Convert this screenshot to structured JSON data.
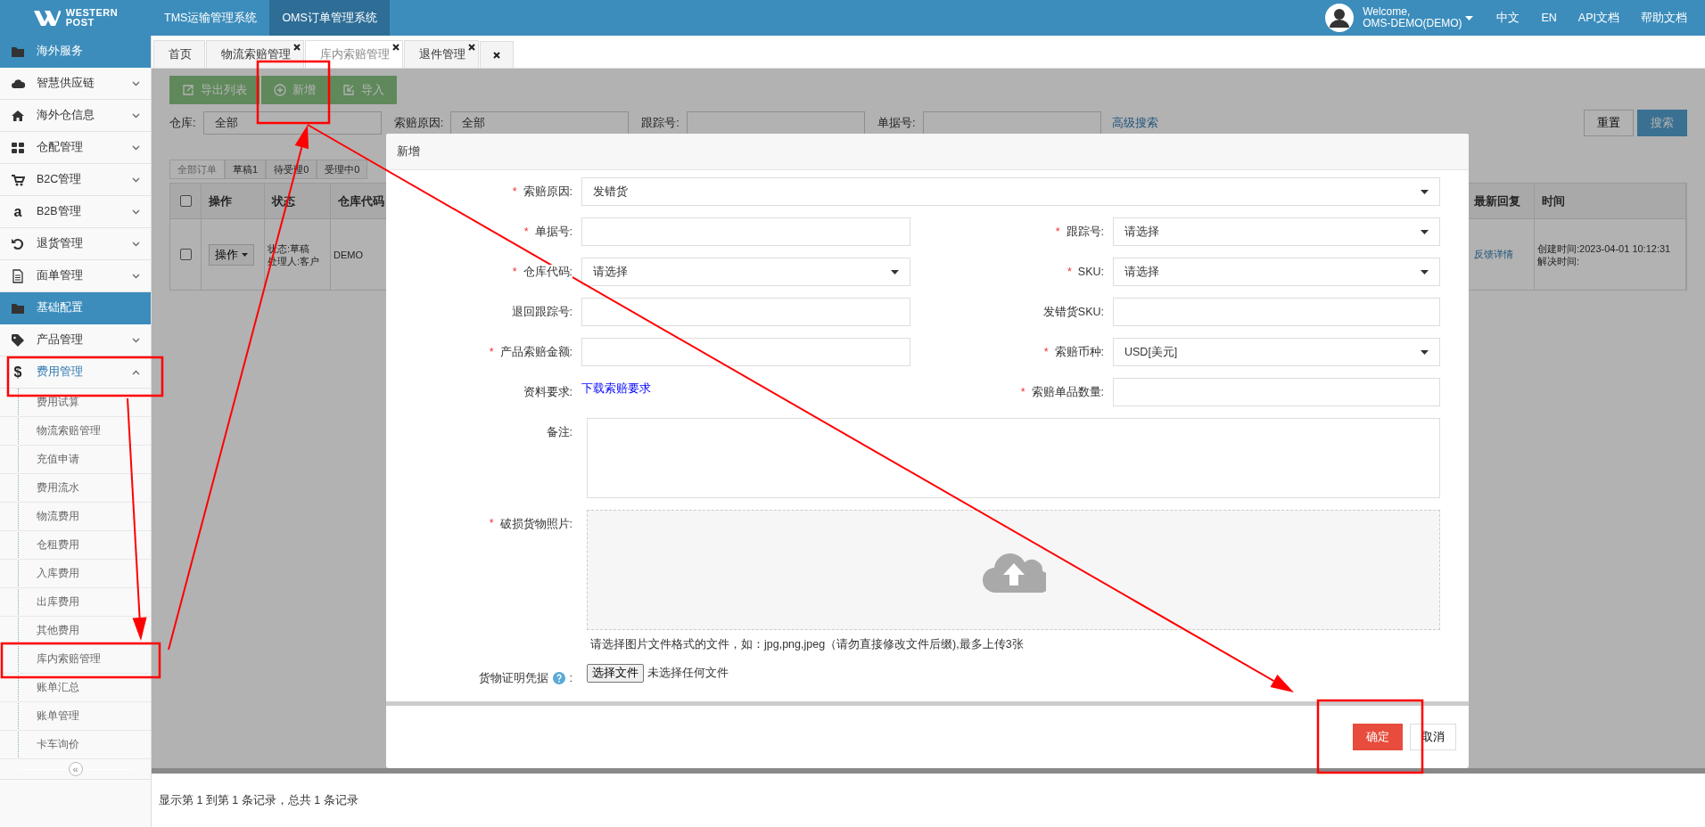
{
  "topbar": {
    "logo_line1": "WESTERN",
    "logo_line2": "POST",
    "nav": [
      {
        "label": "TMS运输管理系统",
        "selected": false
      },
      {
        "label": "OMS订单管理系统",
        "selected": true
      }
    ],
    "welcome": "Welcome,",
    "user": "OMS-DEMO(DEMO)",
    "links": [
      "中文",
      "EN",
      "API文档",
      "帮助文档"
    ]
  },
  "sidebar": {
    "items": [
      {
        "kind": "section",
        "label": "海外服务"
      },
      {
        "kind": "menu",
        "label": "智慧供应链",
        "expanded": false
      },
      {
        "kind": "menu",
        "label": "海外仓信息",
        "expanded": false
      },
      {
        "kind": "menu",
        "label": "仓配管理",
        "expanded": false
      },
      {
        "kind": "menu",
        "label": "B2C管理",
        "expanded": false
      },
      {
        "kind": "menu",
        "glyph": "a",
        "label": "B2B管理",
        "expanded": false
      },
      {
        "kind": "menu",
        "label": "退货管理",
        "expanded": false
      },
      {
        "kind": "menu",
        "label": "面单管理",
        "expanded": false
      },
      {
        "kind": "section",
        "label": "基础配置"
      },
      {
        "kind": "menu",
        "label": "产品管理",
        "expanded": false
      },
      {
        "kind": "menu",
        "glyph": "$",
        "label": "费用管理",
        "expanded": true,
        "children": [
          {
            "label": "费用试算"
          },
          {
            "label": "物流索赔管理"
          },
          {
            "label": "充值申请"
          },
          {
            "label": "费用流水"
          },
          {
            "label": "物流费用"
          },
          {
            "label": "仓租费用"
          },
          {
            "label": "入库费用"
          },
          {
            "label": "出库费用"
          },
          {
            "label": "其他费用"
          },
          {
            "label": "库内索赔管理"
          },
          {
            "label": "账单汇总"
          },
          {
            "label": "账单管理"
          },
          {
            "label": "卡车询价"
          }
        ]
      }
    ],
    "collapse": "«"
  },
  "tabs": [
    {
      "label": "首页",
      "closable": false,
      "selected": false
    },
    {
      "label": "物流索赔管理",
      "closable": true,
      "selected": false
    },
    {
      "label": "库内索赔管理",
      "closable": true,
      "selected": true
    },
    {
      "label": "退件管理",
      "closable": true,
      "selected": false
    }
  ],
  "toolbar": [
    {
      "label": "导出列表"
    },
    {
      "label": "新增"
    },
    {
      "label": "导入"
    }
  ],
  "filters": [
    {
      "label": "仓库:",
      "value": "全部"
    },
    {
      "label": "索赔原因:",
      "value": "全部"
    },
    {
      "label": "跟踪号:"
    },
    {
      "label": "单据号:"
    }
  ],
  "advanced_search": "高级搜索",
  "reset": "重置",
  "search": "搜索",
  "status_tabs": [
    {
      "label": "全部订单",
      "selected": true
    },
    {
      "label": "草稿1",
      "selected": false
    },
    {
      "label": "待受理0",
      "selected": false
    },
    {
      "label": "受理中0",
      "selected": false
    }
  ],
  "table": {
    "header_checked": false,
    "columns": [
      "操作",
      "状态",
      "仓库代码",
      "最新回复",
      "时间"
    ],
    "rows": [
      {
        "checked": false,
        "action": "操作",
        "status_lines": [
          "状态:草稿",
          "处理人:客户"
        ],
        "warehouse": "DEMO",
        "reply": "反馈详情",
        "time_lines": [
          "创建时间:2023-04-01 10:12:31",
          "解决时间:"
        ]
      }
    ]
  },
  "pager_info": "显示第 1 到第 1 条记录，总共 1 条记录",
  "modal": {
    "title": "新增",
    "required_mark": "*",
    "fields": [
      {
        "kind": "select",
        "label": "索赔原因:",
        "required": true,
        "value": "发错货",
        "wide": true
      },
      {
        "kind": "input",
        "label": "单据号:",
        "required": true
      },
      {
        "kind": "select",
        "label": "跟踪号:",
        "required": true,
        "value": "请选择"
      },
      {
        "kind": "select",
        "label": "仓库代码:",
        "required": true,
        "value": "请选择"
      },
      {
        "kind": "select",
        "label": "SKU:",
        "required": true,
        "value": "请选择"
      },
      {
        "kind": "input",
        "label": "退回跟踪号:",
        "required": false
      },
      {
        "kind": "input",
        "label": "发错货SKU:",
        "required": false
      },
      {
        "kind": "input",
        "label": "产品索赔金额:",
        "required": true
      },
      {
        "kind": "select",
        "label": "索赔币种:",
        "required": true,
        "value": "USD[美元]"
      },
      {
        "kind": "link",
        "label": "资料要求:",
        "required": false,
        "value": "下载索赔要求"
      },
      {
        "kind": "input",
        "label": "索赔单品数量:",
        "required": true
      },
      {
        "kind": "textarea",
        "label": "备注:",
        "required": false,
        "wide": true
      },
      {
        "kind": "upload",
        "label": "破损货物照片:",
        "required": true,
        "wide": true,
        "hint": "请选择图片文件格式的文件，如：jpg,png,jpeg（请勿直接修改文件后缀),最多上传3张"
      },
      {
        "kind": "file",
        "label": "货物证明凭据",
        "label_suffix": ":",
        "required": false,
        "button": "选择文件",
        "status": "未选择任何文件"
      }
    ],
    "buttons": [
      {
        "label": "确定",
        "kind": "primary"
      },
      {
        "label": "取消",
        "kind": "default"
      }
    ]
  }
}
